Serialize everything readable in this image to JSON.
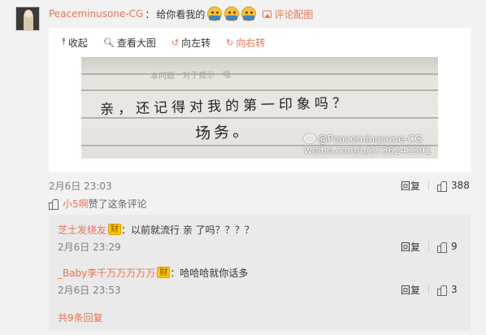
{
  "comment": {
    "username": "Peaceminusone-CG",
    "colon": "：",
    "text": "给你看我的",
    "emoji_count": 3,
    "emoji_icon": "embarrassed-face-emoji",
    "reply_with_pic": "评论配图"
  },
  "toolbar": {
    "collapse": "收起",
    "view_large": "查看大图",
    "rotate_left": "向左转",
    "rotate_right": "向右转"
  },
  "photo": {
    "line1": "亲，还记得对我的第一印象吗？",
    "line2": "场务。",
    "faint_text": "本问题 · 对于提示 · 哦",
    "watermark_line1": "@Peaceminusone-CG",
    "watermark_line2": "weibo.com/u/3736243391"
  },
  "main_meta": {
    "time": "2月6日 23:03",
    "reply_label": "回复",
    "likes": "388"
  },
  "praise": {
    "user": "小5啊",
    "text": " 赞了这条评论"
  },
  "replies": [
    {
      "user": "芝士发烧友",
      "badge": "财",
      "colon": "：",
      "text": "以前就流行 亲 了吗？？？？",
      "time": "2月6日 23:29",
      "reply_label": "回复",
      "likes": "9"
    },
    {
      "user": "_Baby李千万万万万万",
      "badge": "财",
      "colon": "：",
      "text": "哈哈哈就你话多",
      "time": "2月6日 23:53",
      "reply_label": "回复",
      "likes": "3"
    }
  ],
  "total_replies": "共9条回复",
  "colors": {
    "accent": "#eb7350",
    "badge": "#ffc600",
    "background": "#f2f2f2"
  }
}
